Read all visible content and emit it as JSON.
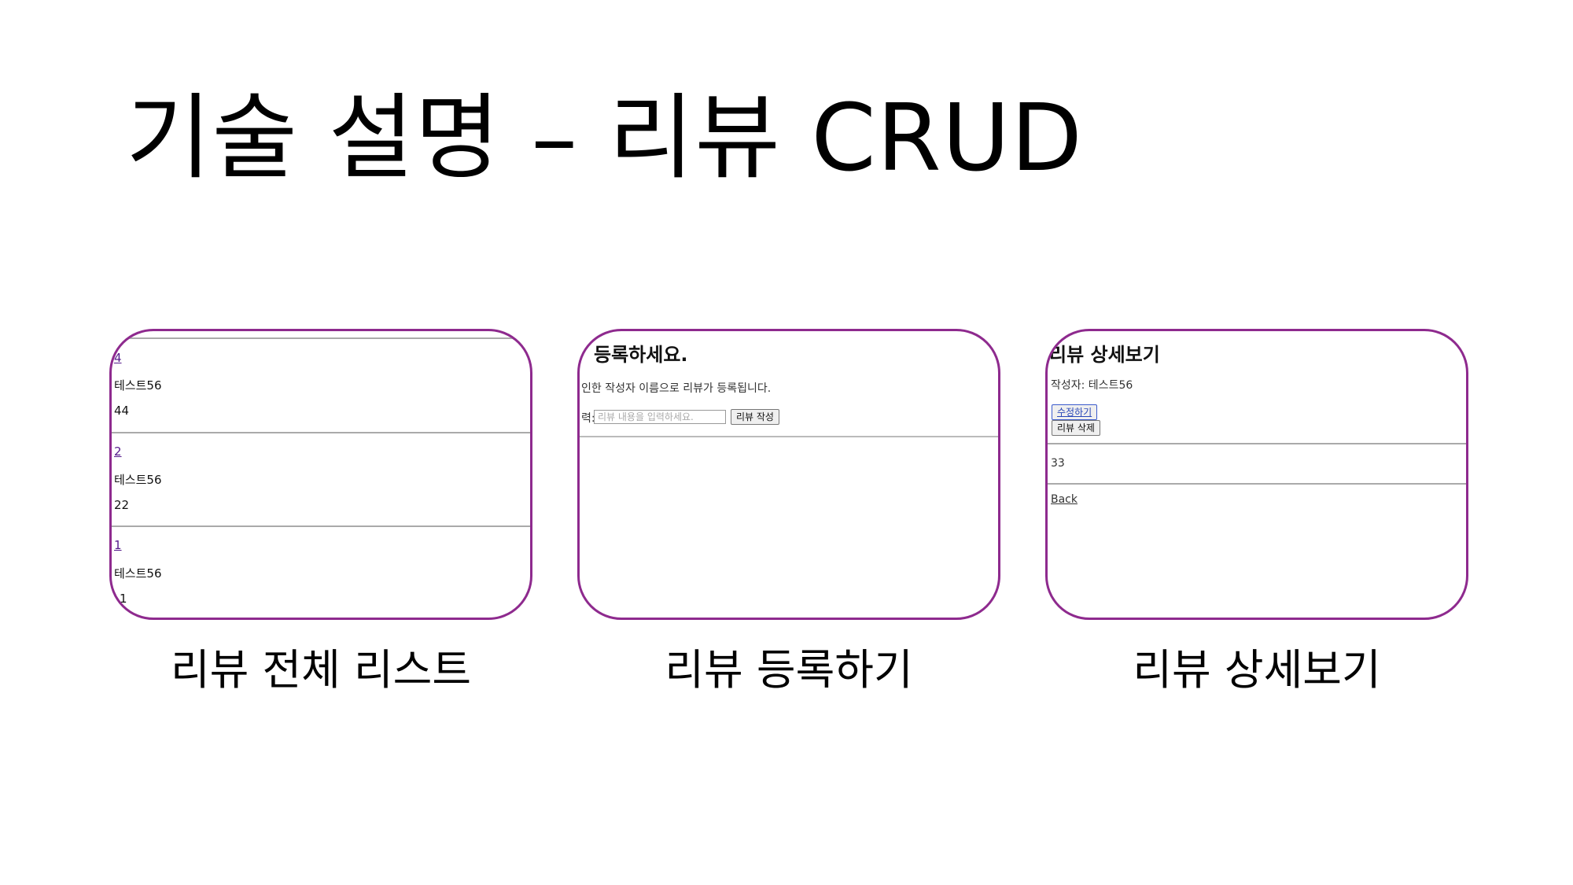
{
  "slide": {
    "title": "기술 설명 – 리뷰 CRUD"
  },
  "panels": [
    {
      "caption": "리뷰 전체 리스트",
      "rows": [
        {
          "id": "4",
          "author": "테스트56",
          "content": "44"
        },
        {
          "id": "2",
          "author": "테스트56",
          "content": "22"
        },
        {
          "id": "1",
          "author": "테스트56",
          "content": "1"
        }
      ]
    },
    {
      "caption": "리뷰 등록하기",
      "heading": "등록하세요.",
      "notice": "인한 작성자 이름으로 리뷰가 등록됩니다.",
      "field_label": "력:",
      "input_placeholder": "리뷰 내용을 입력하세요.",
      "submit_label": "리뷰 작성"
    },
    {
      "caption": "리뷰 상세보기",
      "heading": "리뷰 상세보기",
      "author_line": "작성자: 테스트56",
      "edit_label": "수정하기",
      "delete_label": "리뷰 삭제",
      "content": "33",
      "back_label": "Back"
    }
  ],
  "colors": {
    "frame_border": "#8e2a8e",
    "link": "#551a8b"
  }
}
